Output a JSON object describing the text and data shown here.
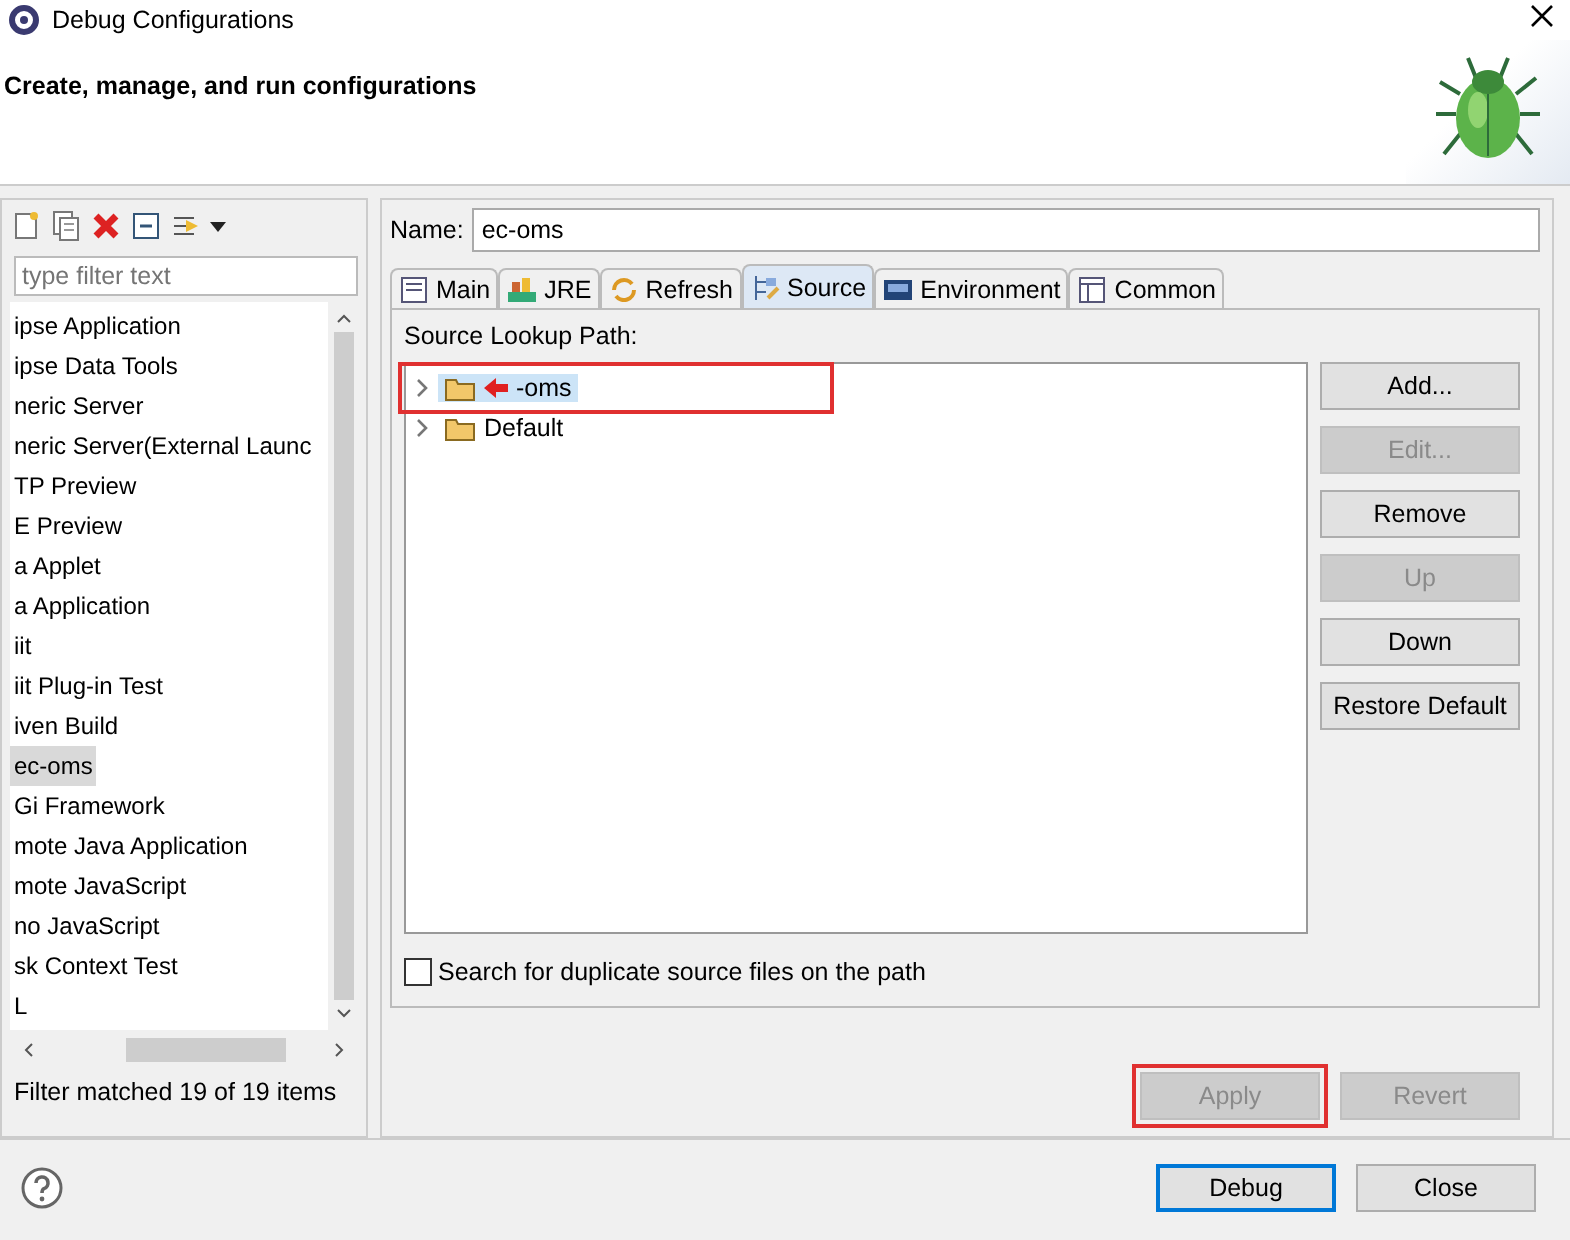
{
  "window": {
    "title": "Debug Configurations"
  },
  "header": {
    "title": "Create, manage, and run configurations"
  },
  "sidebar": {
    "filter": {
      "placeholder": "type filter text"
    },
    "items": [
      {
        "label": "ipse Application",
        "selected": false
      },
      {
        "label": "ipse Data Tools",
        "selected": false
      },
      {
        "label": "neric Server",
        "selected": false
      },
      {
        "label": "neric Server(External Launc",
        "selected": false
      },
      {
        "label": "TP Preview",
        "selected": false
      },
      {
        "label": "E Preview",
        "selected": false
      },
      {
        "label": "a Applet",
        "selected": false
      },
      {
        "label": "a Application",
        "selected": false
      },
      {
        "label": "iit",
        "selected": false
      },
      {
        "label": "iit Plug-in Test",
        "selected": false
      },
      {
        "label": "iven Build",
        "selected": false
      },
      {
        "label": "ec-oms",
        "selected": true
      },
      {
        "label": "Gi Framework",
        "selected": false
      },
      {
        "label": "mote Java Application",
        "selected": false
      },
      {
        "label": "mote JavaScript",
        "selected": false
      },
      {
        "label": "no JavaScript",
        "selected": false
      },
      {
        "label": "sk Context Test",
        "selected": false
      },
      {
        "label": "L",
        "selected": false
      }
    ],
    "status": "Filter matched 19 of 19 items"
  },
  "name_field": {
    "label": "Name:",
    "value": "ec-oms"
  },
  "tabs": [
    {
      "label": "Main",
      "selected": false
    },
    {
      "label": "JRE",
      "selected": false
    },
    {
      "label": "Refresh",
      "selected": false
    },
    {
      "label": "Source",
      "selected": true
    },
    {
      "label": "Environment",
      "selected": false
    },
    {
      "label": "Common",
      "selected": false
    }
  ],
  "source_lookup": {
    "label": "Source Lookup Path:",
    "items": [
      {
        "label": "-oms",
        "selected": true,
        "expanded": false
      },
      {
        "label": "Default",
        "selected": false,
        "expanded": false
      }
    ]
  },
  "side_buttons": [
    {
      "label": "Add...",
      "disabled": false
    },
    {
      "label": "Edit...",
      "disabled": true
    },
    {
      "label": "Remove",
      "disabled": false
    },
    {
      "label": "Up",
      "disabled": true
    },
    {
      "label": "Down",
      "disabled": false
    },
    {
      "label": "Restore Default",
      "disabled": false
    }
  ],
  "duplicate_checkbox": {
    "label": "Search for duplicate source files on the path",
    "checked": false
  },
  "apply_buttons": [
    {
      "label": "Apply",
      "disabled": true
    },
    {
      "label": "Revert",
      "disabled": true
    }
  ],
  "dialog_buttons": [
    {
      "label": "Debug",
      "default": true
    },
    {
      "label": "Close",
      "default": false
    }
  ]
}
